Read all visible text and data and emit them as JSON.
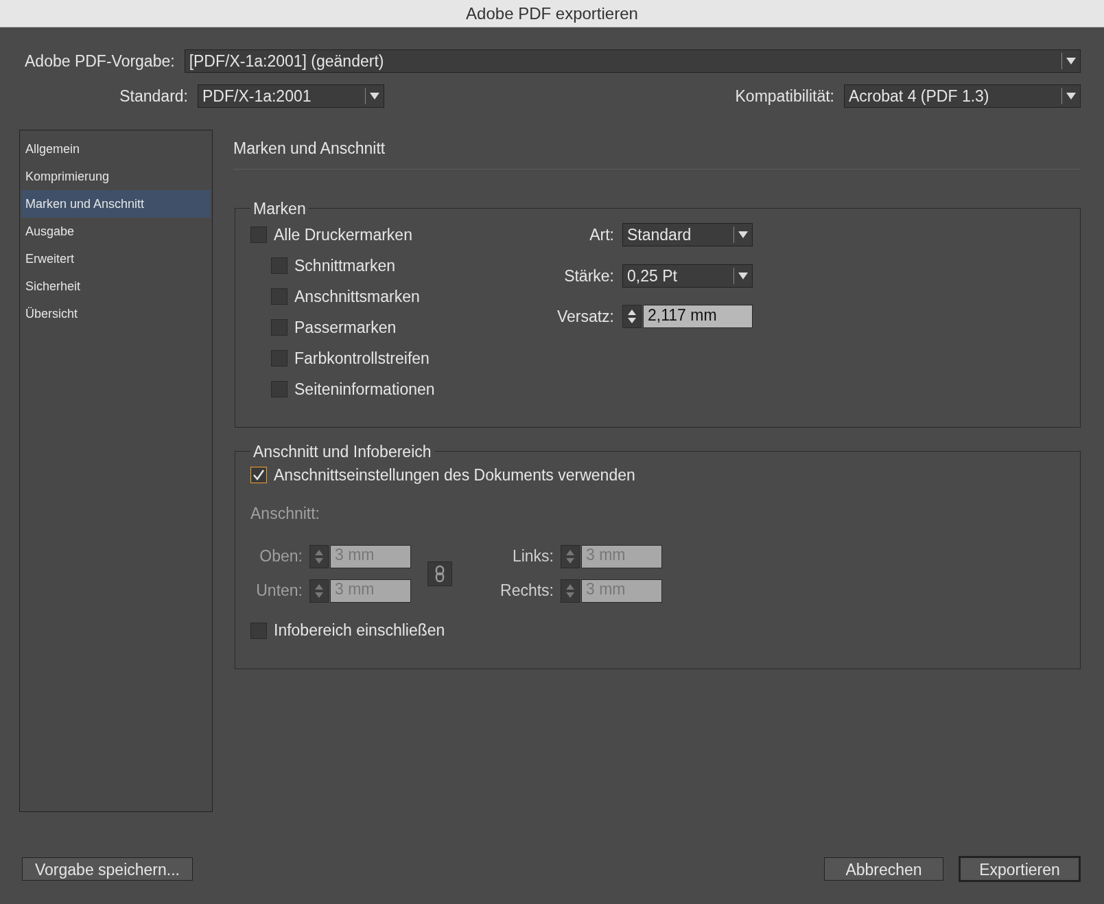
{
  "window": {
    "title": "Adobe PDF exportieren"
  },
  "preset": {
    "label": "Adobe PDF-Vorgabe:",
    "value": "[PDF/X-1a:2001] (geändert)"
  },
  "standard": {
    "label": "Standard:",
    "value": "PDF/X-1a:2001"
  },
  "compatibility": {
    "label": "Kompatibilität:",
    "value": "Acrobat 4 (PDF 1.3)"
  },
  "sidebar": {
    "items": [
      {
        "label": "Allgemein",
        "selected": false
      },
      {
        "label": "Komprimierung",
        "selected": false
      },
      {
        "label": "Marken und Anschnitt",
        "selected": true
      },
      {
        "label": "Ausgabe",
        "selected": false
      },
      {
        "label": "Erweitert",
        "selected": false
      },
      {
        "label": "Sicherheit",
        "selected": false
      },
      {
        "label": "Übersicht",
        "selected": false
      }
    ]
  },
  "panel": {
    "title": "Marken und Anschnitt"
  },
  "marks": {
    "title": "Marken",
    "all": {
      "label": "Alle Druckermarken",
      "checked": false
    },
    "items": [
      {
        "label": "Schnittmarken",
        "checked": false
      },
      {
        "label": "Anschnittsmarken",
        "checked": false
      },
      {
        "label": "Passermarken",
        "checked": false
      },
      {
        "label": "Farbkontrollstreifen",
        "checked": false
      },
      {
        "label": "Seiteninformationen",
        "checked": false
      }
    ],
    "settings": [
      {
        "kind": "dropdown",
        "label": "Art:",
        "value": "Standard"
      },
      {
        "kind": "dropdown",
        "label": "Stärke:",
        "value": "0,25 Pt"
      },
      {
        "kind": "spinner",
        "label": "Versatz:",
        "value": "2,117 mm"
      }
    ]
  },
  "bleed": {
    "title": "Anschnitt und Infobereich",
    "use_document": {
      "label": "Anschnittseinstellungen des Dokuments verwenden",
      "checked": true
    },
    "subtitle": "Anschnitt:",
    "fields_left": [
      {
        "label": "Oben:",
        "value": "3 mm",
        "disabled": true
      },
      {
        "label": "Unten:",
        "value": "3 mm",
        "disabled": true
      }
    ],
    "fields_right": [
      {
        "label": "Links:",
        "value": "3 mm",
        "disabled": true
      },
      {
        "label": "Rechts:",
        "value": "3 mm",
        "disabled": true
      }
    ],
    "slug": {
      "label": "Infobereich einschließen",
      "checked": false
    }
  },
  "buttons": {
    "save": "Vorgabe speichern...",
    "cancel": "Abbrechen",
    "export": "Exportieren"
  }
}
